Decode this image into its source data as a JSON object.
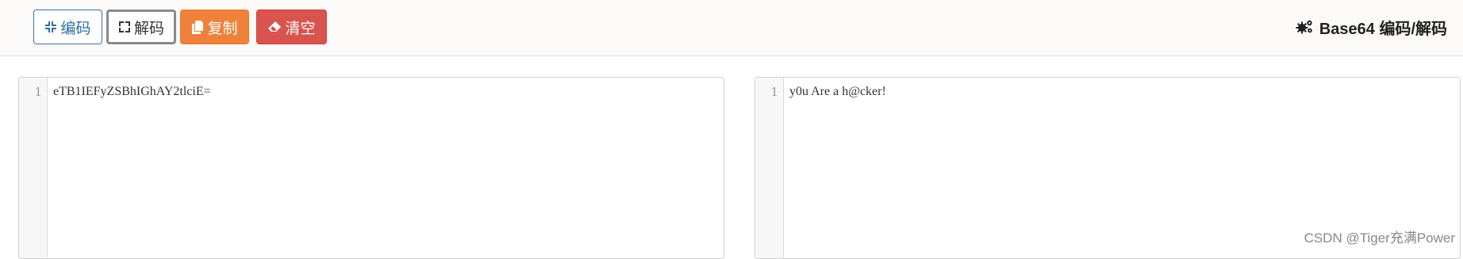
{
  "toolbar": {
    "encode_label": "编码",
    "decode_label": "解码",
    "copy_label": "复制",
    "clear_label": "清空",
    "title": "Base64 编码/解码"
  },
  "input_editor": {
    "line_number": "1",
    "content": "eTB1IEFyZSBhIGhAY2tlciE="
  },
  "output_editor": {
    "line_number": "1",
    "content": "y0u Are a h@cker!"
  },
  "watermark": "CSDN @Tiger充满Power",
  "colors": {
    "encode_border": "#3a6ea5",
    "copy_bg": "#f0813a",
    "clear_bg": "#d9534f"
  }
}
